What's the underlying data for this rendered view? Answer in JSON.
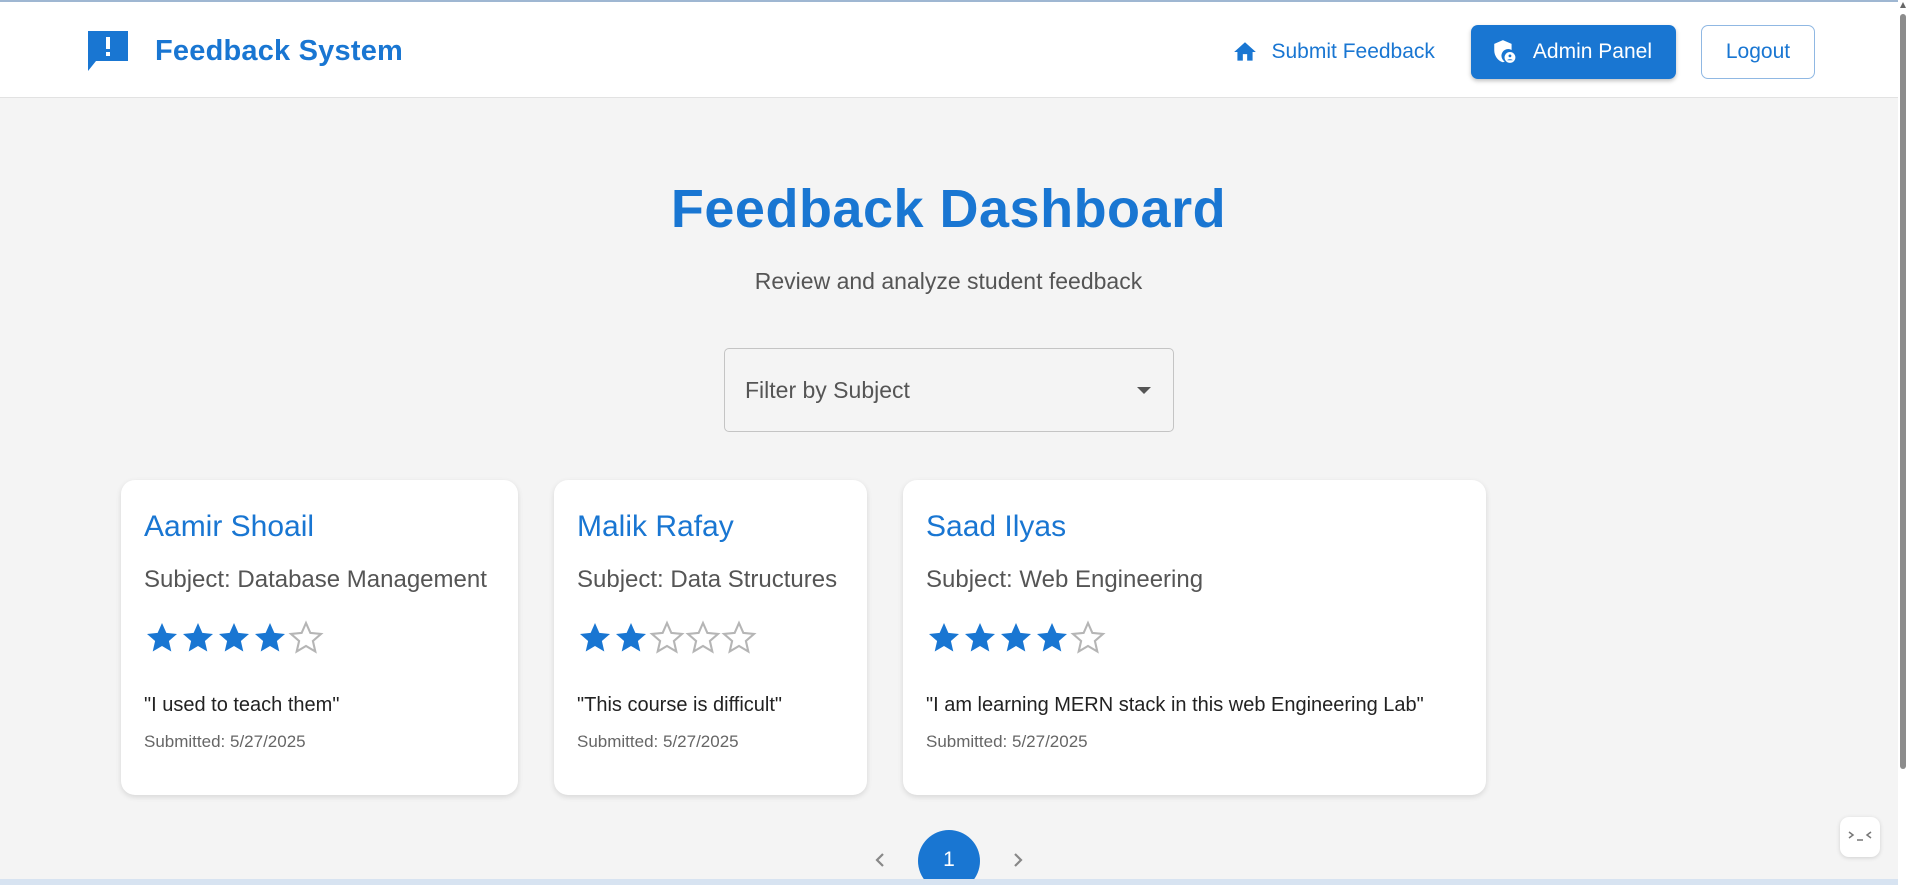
{
  "app": {
    "title": "Feedback System",
    "accent_color": "#1976d2",
    "brand_icon": "feedback-announcement-icon"
  },
  "nav": {
    "submit_label": "Submit Feedback",
    "submit_icon": "home-icon",
    "admin_label": "Admin Panel",
    "admin_icon": "admin-shield-icon",
    "logout_label": "Logout"
  },
  "header": {
    "title": "Feedback Dashboard",
    "subtitle": "Review and analyze student feedback"
  },
  "filter": {
    "label": "Filter by Subject",
    "icon": "dropdown-caret-icon"
  },
  "cards": [
    {
      "name": "Aamir Shoail",
      "subject": "Subject: Database Management",
      "rating": 4,
      "rating_max": 5,
      "comment": "\"I used to teach them\"",
      "submitted": "Submitted: 5/27/2025"
    },
    {
      "name": "Malik Rafay",
      "subject": "Subject: Data Structures",
      "rating": 2,
      "rating_max": 5,
      "comment": "\"This course is difficult\"",
      "submitted": "Submitted: 5/27/2025"
    },
    {
      "name": "Saad Ilyas",
      "subject": "Subject: Web Engineering",
      "rating": 4,
      "rating_max": 5,
      "comment": "\"I am learning MERN stack in this web Engineering Lab\"",
      "submitted": "Submitted: 5/27/2025"
    }
  ],
  "pagination": {
    "current_page": "1",
    "prev_icon": "chevron-left-icon",
    "next_icon": "chevron-right-icon"
  }
}
